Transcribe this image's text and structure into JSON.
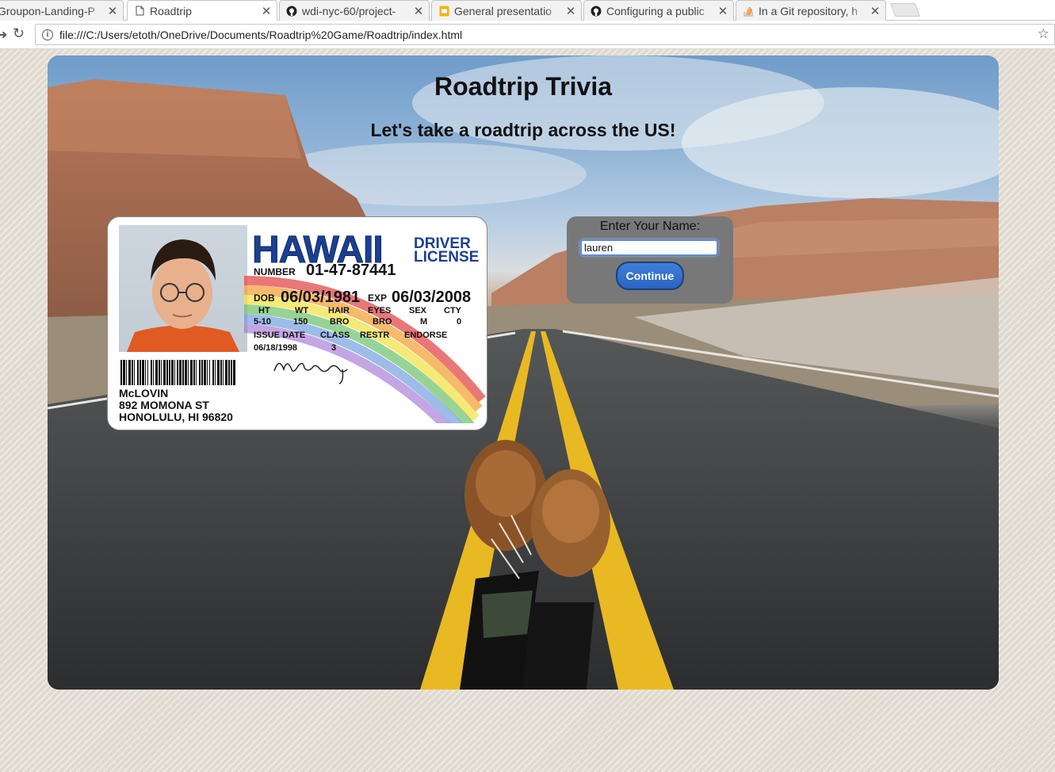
{
  "browser": {
    "tabs": [
      {
        "title": "Groupon-Landing-P",
        "favicon": "generic-page-icon",
        "active": false
      },
      {
        "title": "Roadtrip",
        "favicon": "document-icon",
        "active": true
      },
      {
        "title": "wdi-nyc-60/project-",
        "favicon": "github-icon",
        "active": false
      },
      {
        "title": "General presentatio",
        "favicon": "slides-icon",
        "active": false
      },
      {
        "title": "Configuring a public",
        "favicon": "github-icon",
        "active": false
      },
      {
        "title": "In a Git repository, h",
        "favicon": "stackoverflow-icon",
        "active": false
      }
    ],
    "url": "file:///C:/Users/etoth/OneDrive/Documents/Roadtrip%20Game/Roadtrip/index.html"
  },
  "page": {
    "title": "Roadtrip Trivia",
    "subtitle": "Let's take a roadtrip across the US!"
  },
  "license": {
    "state": "HAWAII",
    "type_line1": "DRIVER",
    "type_line2": "LICENSE",
    "number_label": "NUMBER",
    "number": "01-47-87441",
    "dob_label": "DOB",
    "dob": "06/03/1981",
    "exp_label": "EXP",
    "exp": "06/03/2008",
    "headers": [
      "HT",
      "WT",
      "HAIR",
      "EYES",
      "SEX",
      "CTY"
    ],
    "values": [
      "5-10",
      "150",
      "BRO",
      "BRO",
      "M",
      "0"
    ],
    "issue_headers": [
      "ISSUE DATE",
      "CLASS",
      "RESTR",
      "ENDORSE"
    ],
    "issue_date": "06/18/1998",
    "class": "3",
    "name": "McLOVIN",
    "address1": "892 MOMONA ST",
    "address2": "HONOLULU, HI 96820"
  },
  "form": {
    "label": "Enter Your Name:",
    "value": "lauren",
    "button": "Continue"
  },
  "colors": {
    "button": "#2a64c2",
    "form_bg": "#787878",
    "license_blue": "#1c3f8f"
  }
}
